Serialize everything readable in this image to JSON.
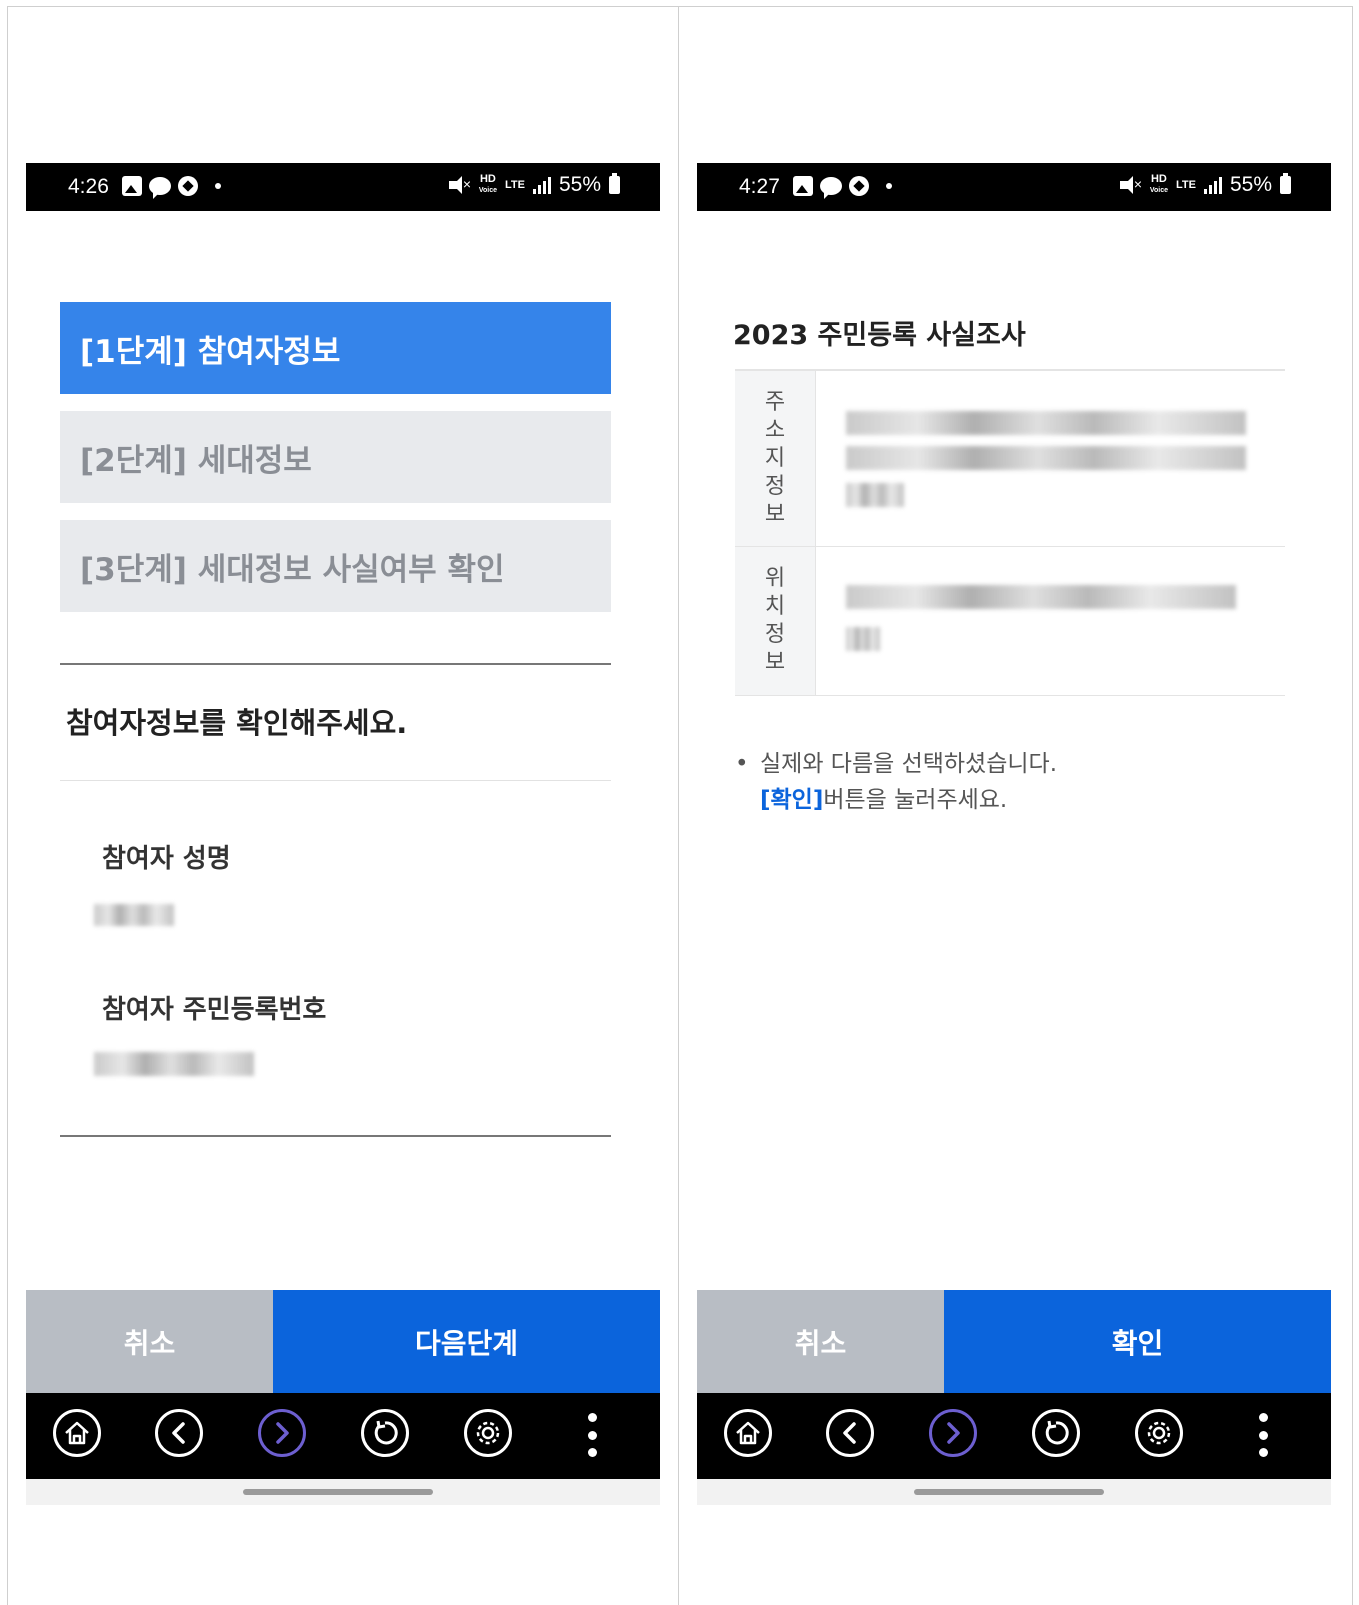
{
  "left_screen": {
    "status_bar": {
      "time": "4:26",
      "network": "HD",
      "network_sub": "Voice",
      "lte": "LTE",
      "battery": "55%"
    },
    "steps": [
      {
        "label": "[1단계] 참여자정보",
        "active": true
      },
      {
        "label": "[2단계] 세대정보",
        "active": false
      },
      {
        "label": "[3단계] 세대정보 사실여부 확인",
        "active": false
      }
    ],
    "section_title": "참여자정보를 확인해주세요.",
    "fields": [
      {
        "label": "참여자 성명"
      },
      {
        "label": "참여자 주민등록번호"
      }
    ],
    "buttons": {
      "cancel": "취소",
      "next": "다음단계"
    }
  },
  "right_screen": {
    "status_bar": {
      "time": "4:27",
      "network": "HD",
      "network_sub": "Voice",
      "lte": "LTE",
      "battery": "55%"
    },
    "title": "2023 주민등록 사실조사",
    "table_rows": [
      {
        "header_chars": [
          "주",
          "소",
          "지",
          "정",
          "보"
        ]
      },
      {
        "header_chars": [
          "위",
          "치",
          "정",
          "보"
        ]
      }
    ],
    "note": {
      "bullet": "•",
      "line1": "실제와 다름을 선택하셨습니다.",
      "link": "[확인]",
      "line2_rest": "버튼을 눌러주세요."
    },
    "buttons": {
      "cancel": "취소",
      "confirm": "확인"
    }
  },
  "nav_icons": [
    "home-icon",
    "back-icon",
    "forward-icon",
    "refresh-icon",
    "settings-icon",
    "more-icon"
  ],
  "colors": {
    "accent": "#0b64dc",
    "step_active": "#3584ea",
    "step_inactive": "#e8eaed",
    "cancel": "#b8bdc4",
    "forward_ring": "#6d5fd0"
  }
}
